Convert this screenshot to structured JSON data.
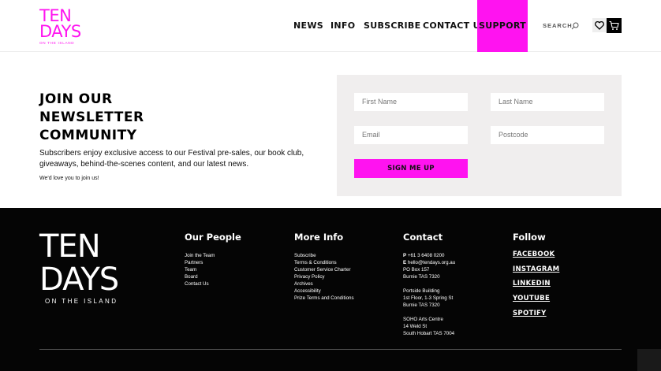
{
  "header": {
    "logo_big_line1": "TEN",
    "logo_big_line2": "DAYS",
    "logo_small": "ON THE ISLAND",
    "nav": [
      {
        "label": "NEWS"
      },
      {
        "label": "INFO"
      },
      {
        "label": "SUBSCRIBE"
      },
      {
        "label": "CONTACT US"
      },
      {
        "label": "SUPPORT"
      }
    ],
    "search_label": "SEARCH",
    "accent_color": "#ff13f0"
  },
  "newsletter": {
    "title_line1": "JOIN OUR",
    "title_line2": "NEWSLETTER",
    "title_line3": "COMMUNITY",
    "description": "Subscribers enjoy exclusive access to our Festival pre-sales, our book club, giveaways, behind-the-scenes content, and our latest news.",
    "small_note": "We'd love you to join us!",
    "fields": {
      "first_name": "First Name",
      "last_name": "Last Name",
      "email": "Email",
      "postcode": "Postcode"
    },
    "submit_label": "SIGN ME UP"
  },
  "footer": {
    "logo_big_line1": "TEN",
    "logo_big_line2": "DAYS",
    "logo_small": "ON THE ISLAND",
    "our_people": {
      "heading": "Our People",
      "links": [
        "Join the Team",
        "Partners",
        "Team",
        "Board",
        "Contact Us"
      ]
    },
    "more_info": {
      "heading": "More Info",
      "links": [
        "Subscribe",
        "Terms & Conditions",
        "Customer Service Charter",
        "Privacy Policy",
        "Archives",
        "Accessibility",
        "Prize Terms and Conditions"
      ]
    },
    "contact": {
      "heading": "Contact",
      "phone_prefix": "P",
      "phone": "+61 3 6408 0200",
      "email_prefix": "E",
      "email": "hello@tendays.org.au",
      "po_box": "PO Box 157",
      "po_city": "Burnie TAS 7320",
      "addr1_name": "Portside Building",
      "addr1_street": "1st Floor, 1-3 Spring St",
      "addr1_city": "Burnie TAS 7320",
      "addr2_name": "SOHO Arts Centre",
      "addr2_street": "14 Weld St",
      "addr2_city": "South Hobart TAS 7004"
    },
    "follow": {
      "heading": "Follow",
      "links": [
        "FACEBOOK",
        "INSTAGRAM",
        "LINKEDIN",
        "YOUTUBE",
        "SPOTIFY"
      ]
    }
  }
}
